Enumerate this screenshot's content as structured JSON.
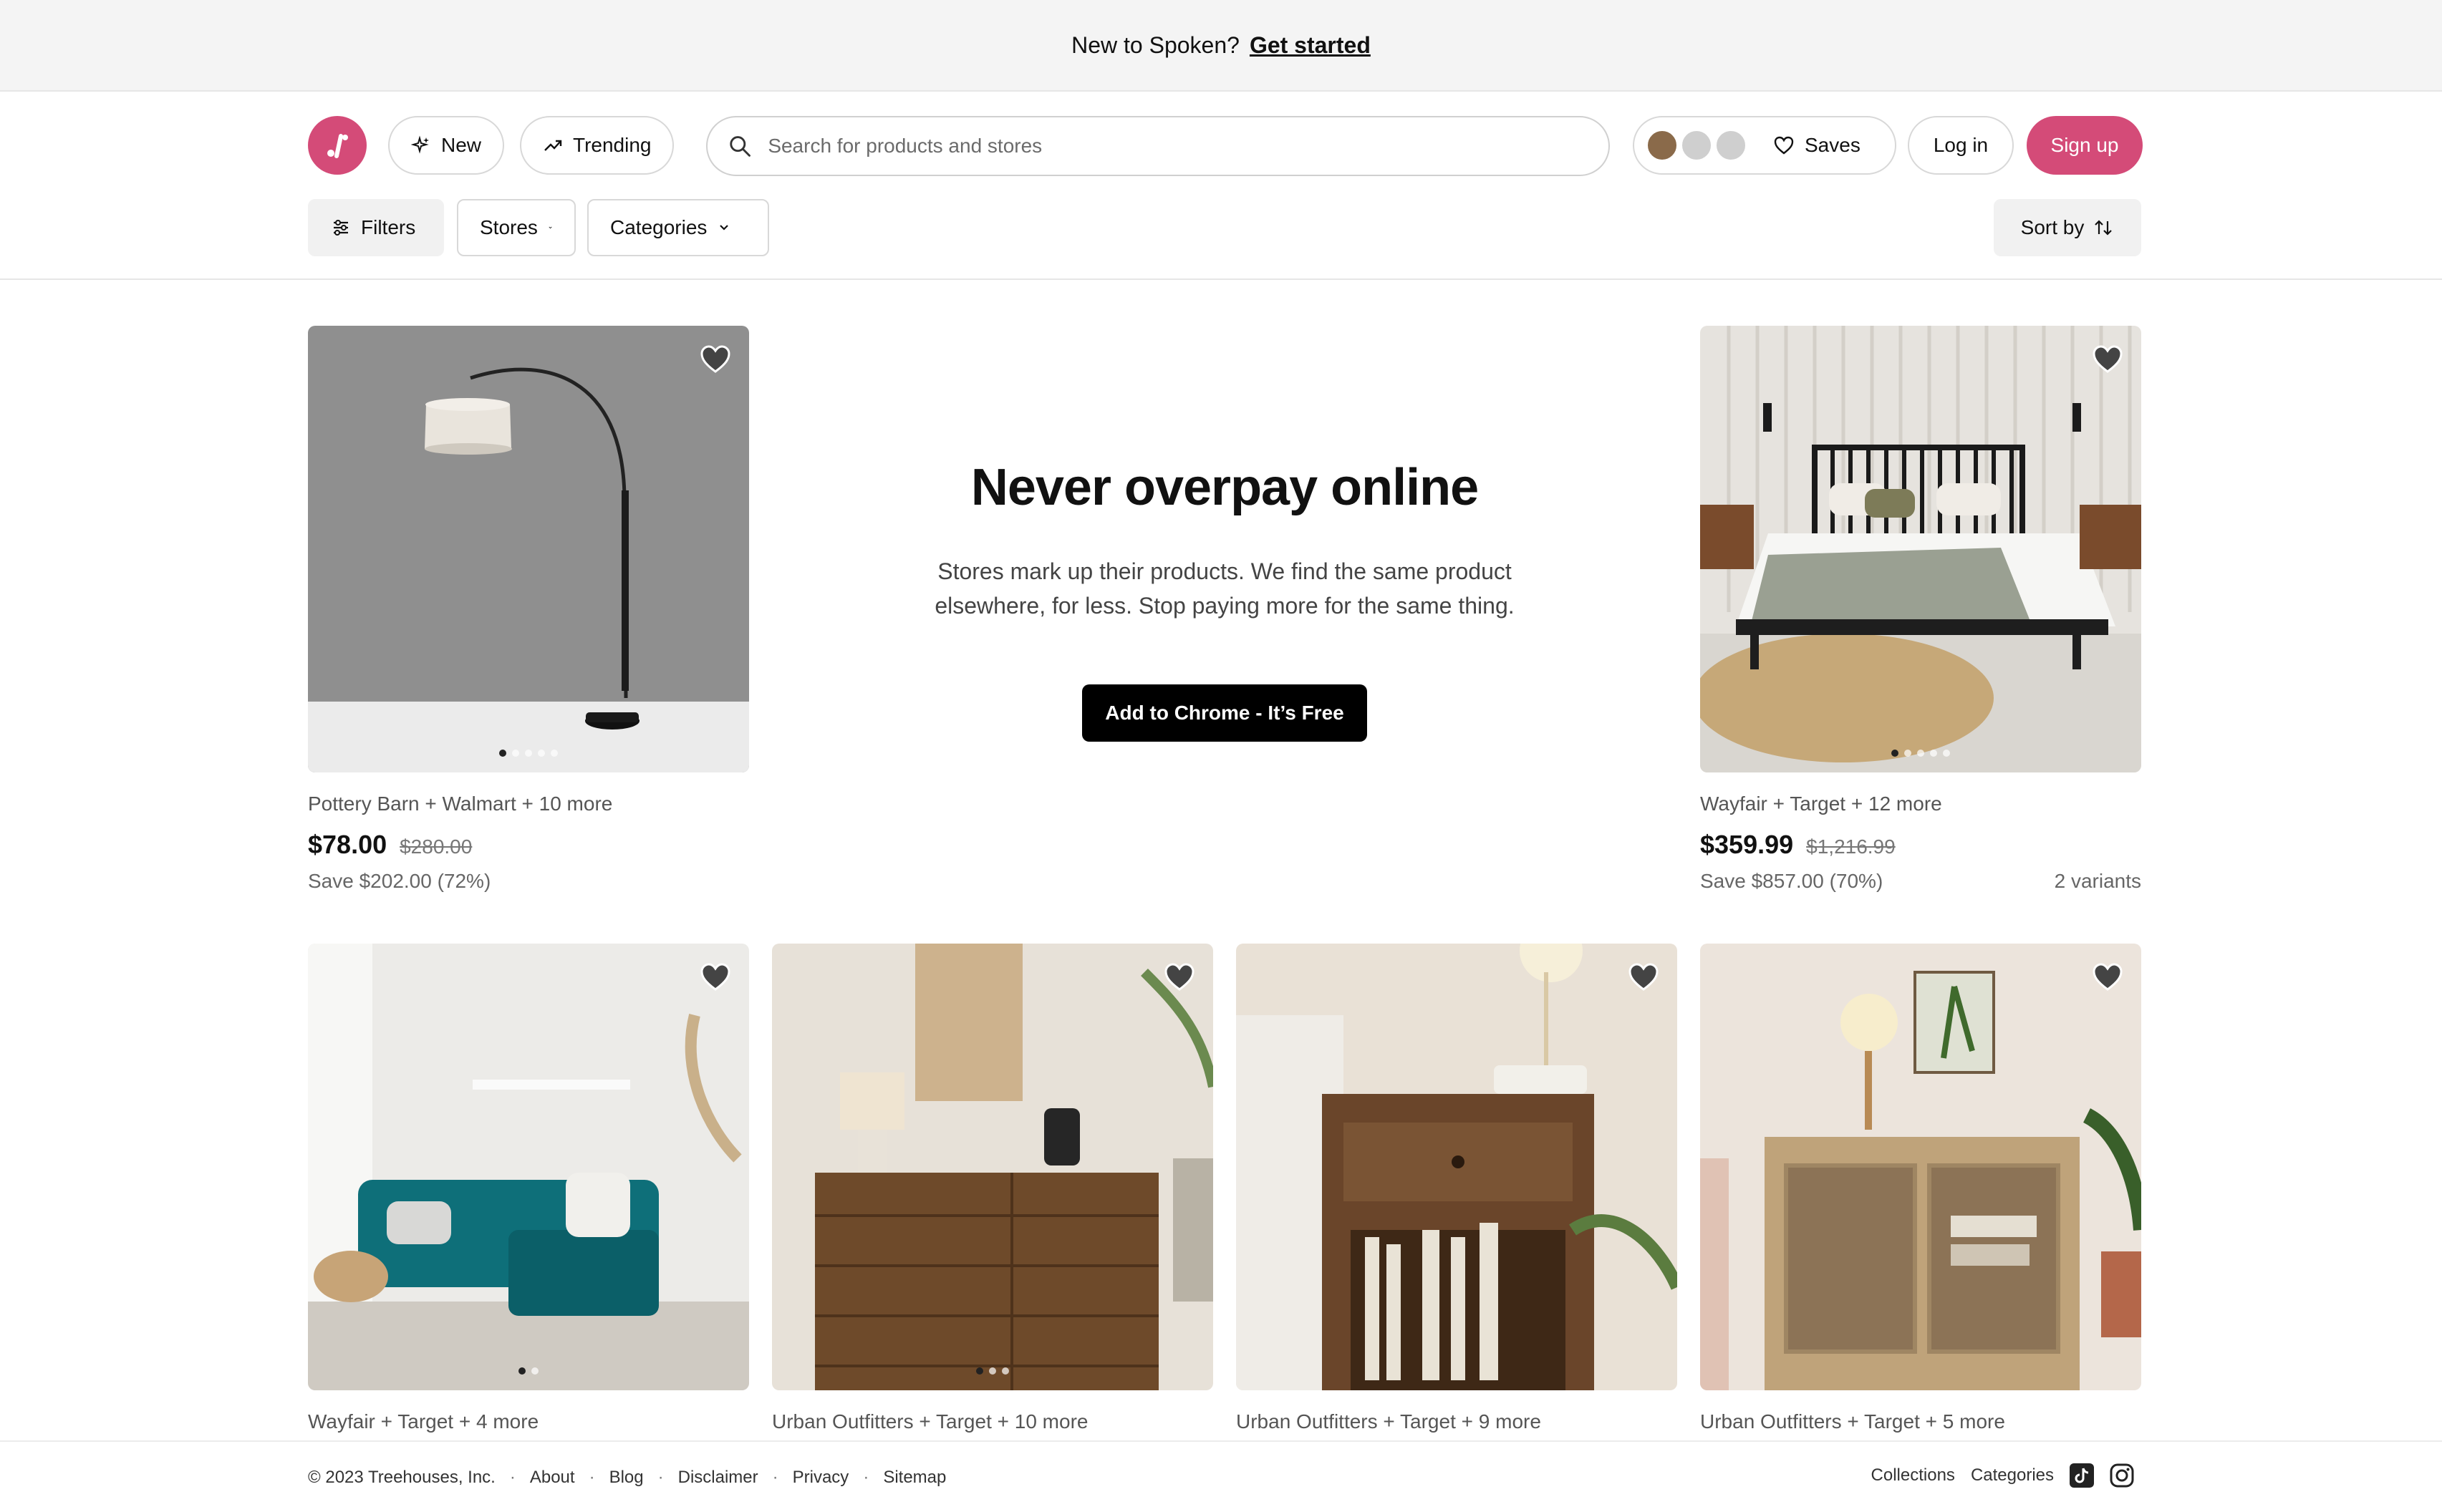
{
  "announcement": {
    "text": "New to Spoken?",
    "link": "Get started"
  },
  "header": {
    "nav": {
      "new": "New",
      "trending": "Trending"
    },
    "search": {
      "placeholder": "Search for products and stores"
    },
    "saves": "Saves",
    "login": "Log in",
    "signup": "Sign up",
    "accent": "#d44b78"
  },
  "filters": {
    "filters": "Filters",
    "stores": "Stores",
    "categories": "Categories",
    "sort": "Sort by"
  },
  "promo": {
    "title": "Never overpay online",
    "body": "Stores mark up their products. We find the same product elsewhere, for less. Stop paying more for the same thing.",
    "cta": "Add to Chrome - It’s Free"
  },
  "products": [
    {
      "stores": "Pottery Barn + Walmart + 10 more",
      "price": "$78.00",
      "original": "$280.00",
      "save": "Save $202.00 (72%)",
      "variants": ""
    },
    {
      "stores": "Wayfair + Target + 12 more",
      "price": "$359.99",
      "original": "$1,216.99",
      "save": "Save $857.00 (70%)",
      "variants": "2 variants"
    },
    {
      "stores": "Wayfair + Target + 4 more"
    },
    {
      "stores": "Urban Outfitters + Target + 10 more"
    },
    {
      "stores": "Urban Outfitters + Target + 9 more"
    },
    {
      "stores": "Urban Outfitters + Target + 5 more"
    }
  ],
  "footer": {
    "copyright": "© 2023 Treehouses, Inc.",
    "links": [
      "About",
      "Blog",
      "Disclaimer",
      "Privacy",
      "Sitemap"
    ],
    "right": [
      "Collections",
      "Categories"
    ]
  }
}
